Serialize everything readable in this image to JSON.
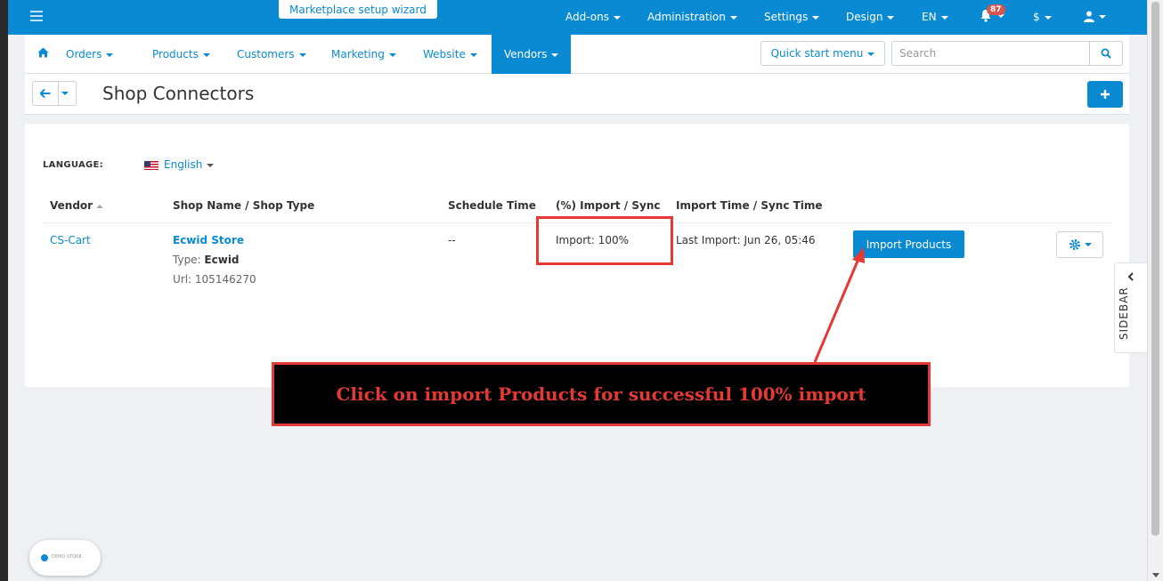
{
  "topbar": {
    "wizard": "Marketplace setup wizard",
    "items": [
      "Add-ons",
      "Administration",
      "Settings",
      "Design",
      "EN"
    ],
    "notifications": "87",
    "currency": "$"
  },
  "nav": {
    "items": [
      "Orders",
      "Products",
      "Customers",
      "Marketing",
      "Website",
      "Vendors"
    ],
    "quick_start": "Quick start menu",
    "search_placeholder": "Search"
  },
  "header": {
    "title": "Shop Connectors"
  },
  "content": {
    "language_label": "LANGUAGE:",
    "language_value": "English",
    "columns": {
      "vendor": "Vendor",
      "shop": "Shop Name  /  Shop Type",
      "schedule": "Schedule Time",
      "import_sync": "(%) Import / Sync",
      "time": "Import Time  /  Sync Time"
    },
    "row": {
      "vendor": "CS-Cart",
      "shop_name": "Ecwid Store",
      "type_label": "Type: ",
      "type_value": "Ecwid",
      "url": "Url: 105146270",
      "schedule": "--",
      "import": "Import: 100%",
      "last_import": "Last Import: Jun 26, 05:46",
      "button": "Import Products"
    }
  },
  "sidebar_label": "SIDEBAR",
  "annotation": "Click on import Products for successful 100% import",
  "demo_label": "DEMO STORE",
  "colors": {
    "primary": "#0a8ad2",
    "highlight": "#e53935",
    "background": "#eef0f3"
  }
}
